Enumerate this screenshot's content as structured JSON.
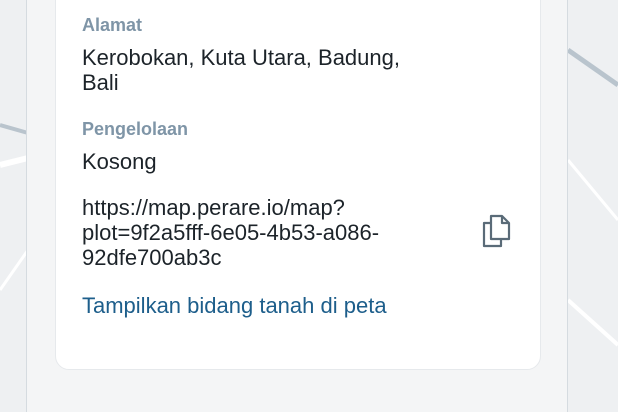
{
  "details": {
    "address_label": "Alamat",
    "address_line1": "Kerobokan, Kuta Utara, Badung,",
    "address_line2": "Bali",
    "management_label": "Pengelolaan",
    "management_value": "Kosong",
    "url_line1": "https://map.perare.io/map?",
    "url_line2": "plot=9f2a5fff-6e05-4b53-a086-",
    "url_line3": "92dfe700ab3c",
    "show_on_map_link": "Tampilkan bidang tanah di peta"
  },
  "icons": {
    "copy": "copy-icon"
  },
  "colors": {
    "label": "#7f95a7",
    "text": "#1c2329",
    "link": "#1d5e8b"
  }
}
